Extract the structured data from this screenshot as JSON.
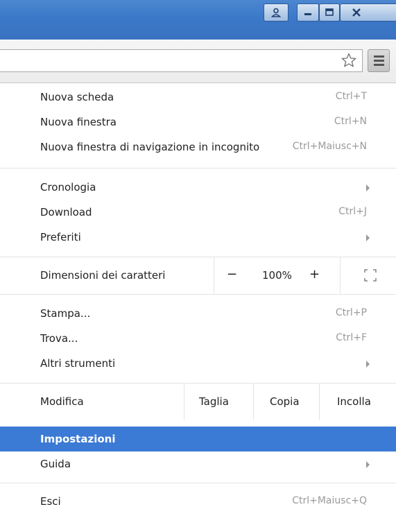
{
  "window": {
    "buttons": [
      {
        "icon": "user-icon"
      },
      {
        "icon": "minimize-icon"
      },
      {
        "icon": "maximize-icon"
      },
      {
        "icon": "close-icon"
      }
    ]
  },
  "toolbar": {
    "bookmark_icon": "star-icon",
    "menu_icon": "hamburger-menu-icon"
  },
  "menu": {
    "group1": [
      {
        "label": "Nuova scheda",
        "shortcut": "Ctrl+T"
      },
      {
        "label": "Nuova finestra",
        "shortcut": "Ctrl+N"
      },
      {
        "label": "Nuova finestra di navigazione in incognito",
        "shortcut": "Ctrl+Maiusc+N"
      }
    ],
    "group2": [
      {
        "label": "Cronologia",
        "submenu": true
      },
      {
        "label": "Download",
        "shortcut": "Ctrl+J"
      },
      {
        "label": "Preferiti",
        "submenu": true
      }
    ],
    "zoom": {
      "label": "Dimensioni dei caratteri",
      "minus": "−",
      "value": "100%",
      "plus": "+",
      "fullscreen_icon": "fullscreen-icon"
    },
    "group3": [
      {
        "label": "Stampa...",
        "shortcut": "Ctrl+P"
      },
      {
        "label": "Trova...",
        "shortcut": "Ctrl+F"
      },
      {
        "label": "Altri strumenti",
        "submenu": true
      }
    ],
    "edit": {
      "label": "Modifica",
      "cut": "Taglia",
      "copy": "Copia",
      "paste": "Incolla"
    },
    "group4": [
      {
        "label": "Impostazioni",
        "selected": true
      },
      {
        "label": "Guida",
        "submenu": true
      }
    ],
    "group5": [
      {
        "label": "Esci",
        "shortcut": "Ctrl+Maiusc+Q"
      }
    ]
  },
  "colors": {
    "titlebar": "#3b78c8",
    "selection": "#3b7ad5",
    "shortcut_text": "#9a9a9a"
  }
}
